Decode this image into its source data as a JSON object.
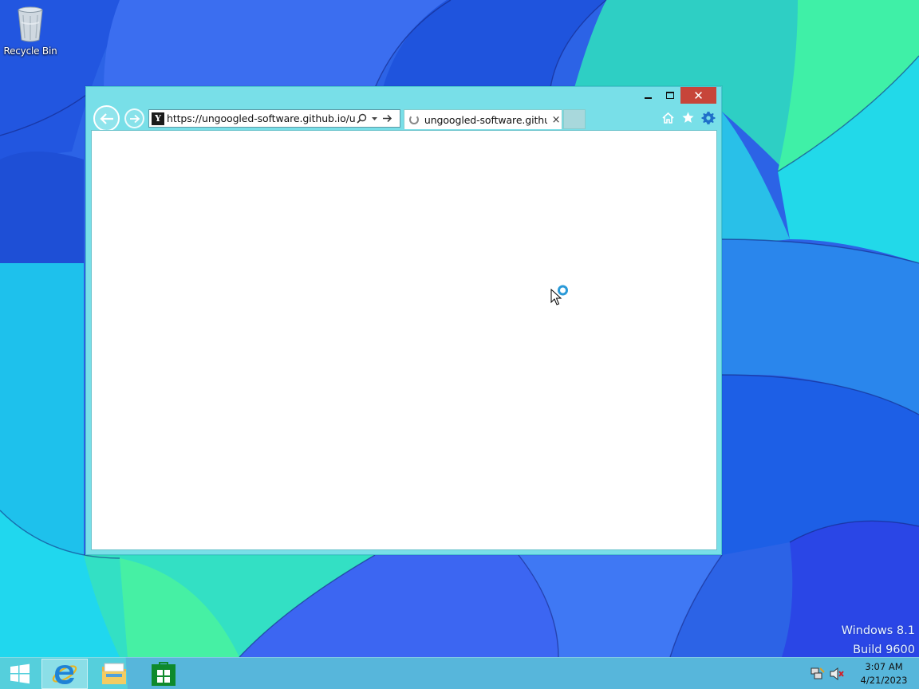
{
  "desktop": {
    "icons": [
      {
        "label": "Recycle Bin",
        "icon": "recycle-bin-icon"
      }
    ],
    "watermark": {
      "line1": "Windows 8.1",
      "line2": "Build 9600"
    }
  },
  "browser": {
    "caption": {
      "minimize": "–",
      "maximize": "□",
      "close": "✕"
    },
    "address": {
      "value": "https://ungoogled-software.github.io/ungoo",
      "favicon": "Y"
    },
    "tab": {
      "label": "ungoogled-software.github...",
      "close": "×",
      "state": "loading"
    },
    "commands": [
      "home-icon",
      "favorites-star-icon",
      "settings-gear-icon"
    ],
    "content": {
      "state": "blank, loading"
    }
  },
  "taskbar": {
    "pinned": [
      "start-button",
      "internet-explorer",
      "file-explorer",
      "store"
    ],
    "active": "internet-explorer",
    "clock": {
      "time": "3:07 AM",
      "date": "4/21/2023"
    },
    "tray": [
      "network-icon",
      "volume-muted-icon"
    ]
  },
  "colors": {
    "window_frame": "#78dfe8",
    "close_button": "#c7453a",
    "taskbar": "#64cdd7",
    "wallpaper_blue": "#2a5fe0",
    "wallpaper_cyan": "#1ee0e8",
    "wallpaper_green": "#39e6a8"
  }
}
